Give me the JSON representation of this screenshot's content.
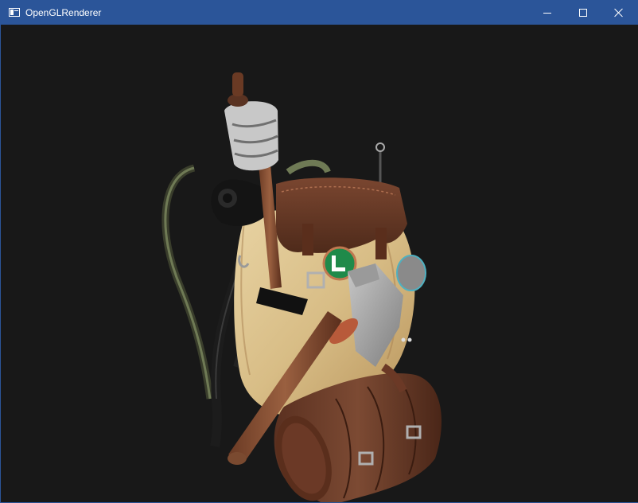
{
  "window": {
    "title": "OpenGLRenderer",
    "title_color": "#2b5599",
    "controls": {
      "minimize_icon": "minimize-icon",
      "maximize_icon": "maximize-icon",
      "close_icon": "close-icon"
    }
  },
  "viewport": {
    "background": "#181818",
    "model": "backpack-model"
  }
}
